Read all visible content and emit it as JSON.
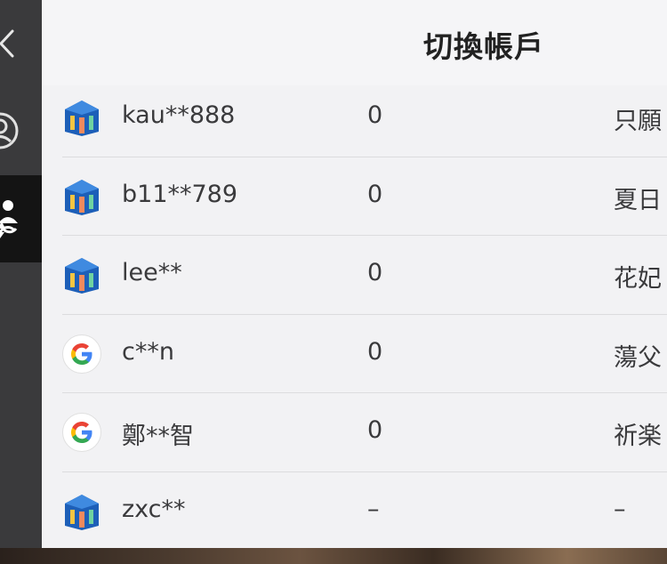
{
  "header": {
    "title": "切換帳戶"
  },
  "sidebar": {
    "items": [
      {
        "icon": "back-icon"
      },
      {
        "icon": "account-icon"
      },
      {
        "icon": "switch-account-icon",
        "active": true
      }
    ]
  },
  "accounts": [
    {
      "type": "game",
      "name": "kau**888",
      "count": "0",
      "server": "只願"
    },
    {
      "type": "game",
      "name": "b11**789",
      "count": "0",
      "server": "夏日"
    },
    {
      "type": "game",
      "name": "lee**",
      "count": "0",
      "server": "花妃"
    },
    {
      "type": "google",
      "name": "c**n",
      "count": "0",
      "server": "蕩父"
    },
    {
      "type": "google",
      "name": "鄭**智",
      "count": "0",
      "server": "祈楽"
    },
    {
      "type": "game",
      "name": "zxc**",
      "count": "–",
      "server": "–"
    }
  ],
  "colors": {
    "sidebar": "#3a3a3c",
    "sidebar_active": "#141414",
    "panel": "#f2f2f4",
    "text": "#3a3a3c"
  }
}
